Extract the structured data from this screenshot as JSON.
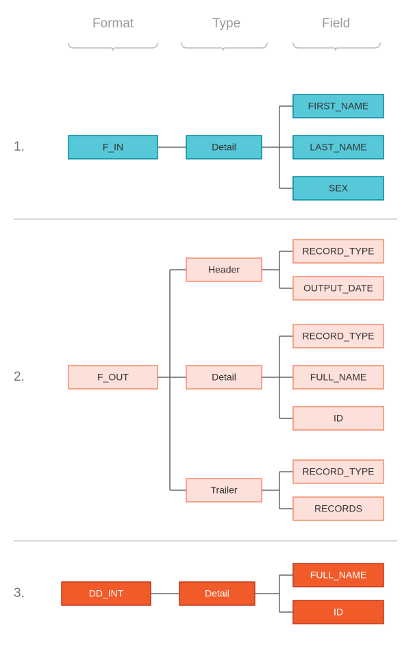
{
  "headers": {
    "format": "Format",
    "type": "Type",
    "field": "Field"
  },
  "rows": {
    "r1": {
      "num": "1.",
      "format": "F_IN",
      "types": {
        "t1": "Detail"
      },
      "fields": {
        "f1": "FIRST_NAME",
        "f2": "LAST_NAME",
        "f3": "SEX"
      }
    },
    "r2": {
      "num": "2.",
      "format": "F_OUT",
      "types": {
        "t1": "Header",
        "t2": "Detail",
        "t3": "Trailer"
      },
      "fields": {
        "h1": "RECORD_TYPE",
        "h2": "OUTPUT_DATE",
        "d1": "RECORD_TYPE",
        "d2": "FULL_NAME",
        "d3": "ID",
        "t1": "RECORD_TYPE",
        "t2": "RECORDS"
      }
    },
    "r3": {
      "num": "3.",
      "format": "DD_INT",
      "types": {
        "t1": "Detail"
      },
      "fields": {
        "f1": "FULL_NAME",
        "f2": "ID"
      }
    }
  }
}
